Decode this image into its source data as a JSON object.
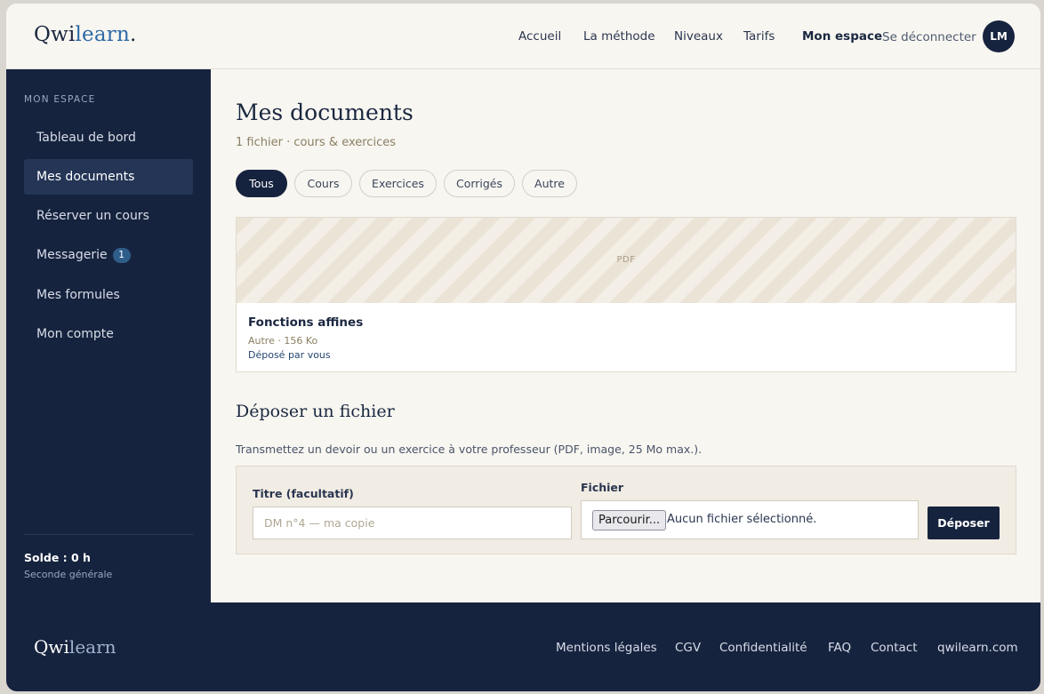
{
  "header": {
    "logo_main": "Qwi",
    "logo_accent": "learn",
    "logo_dot": ".",
    "nav": [
      "Accueil",
      "La méthode",
      "Niveaux",
      "Tarifs"
    ],
    "my_space": "Mon espace",
    "logout": "Se déconnecter",
    "avatar_initials": "LM"
  },
  "sidebar": {
    "section_title": "MON ESPACE",
    "items": [
      {
        "label": "Tableau de bord"
      },
      {
        "label": "Mes documents",
        "active": true
      },
      {
        "label": "Réserver un cours"
      },
      {
        "label": "Messagerie",
        "badge": "1"
      },
      {
        "label": "Mes formules"
      },
      {
        "label": "Mon compte"
      }
    ],
    "balance": "Solde : 0 h",
    "level": "Seconde générale"
  },
  "main": {
    "title": "Mes documents",
    "subtitle": "1 fichier · cours & exercices",
    "filters": [
      "Tous",
      "Cours",
      "Exercices",
      "Corrigés",
      "Autre"
    ],
    "active_filter": "Tous",
    "document": {
      "thumb_label": "PDF",
      "name": "Fonctions affines",
      "meta": "Autre · 156 Ko",
      "owner": "Déposé par vous"
    },
    "upload": {
      "title": "Déposer un fichier",
      "description": "Transmettez un devoir ou un exercice à votre professeur (PDF, image, 25 Mo max.).",
      "title_label": "Titre (facultatif)",
      "title_placeholder": "DM n°4 — ma copie",
      "file_label": "Fichier",
      "browse_button": "Parcourir...",
      "file_status": "Aucun fichier sélectionné.",
      "submit": "Déposer"
    }
  },
  "footer": {
    "logo_main": "Qwi",
    "logo_accent": "learn",
    "links": [
      "Mentions légales",
      "CGV",
      "Confidentialité",
      "FAQ",
      "Contact",
      "qwilearn.com"
    ]
  },
  "colors": {
    "navy": "#16233e",
    "background": "#f8f6f1",
    "accent_blue": "#2e6aa6",
    "muted_gold": "#8a7f62"
  }
}
